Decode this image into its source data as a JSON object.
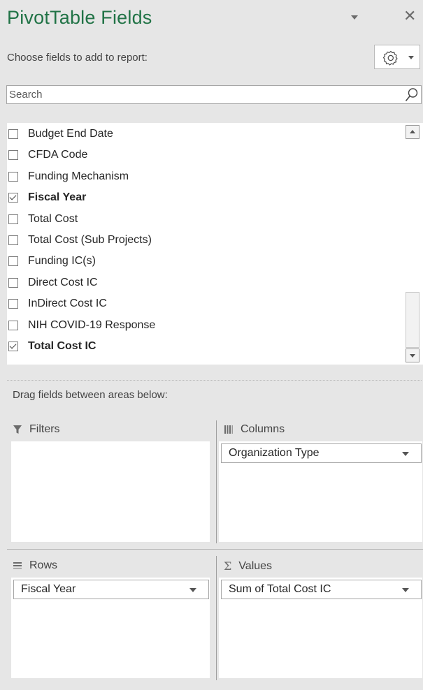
{
  "pane": {
    "title": "PivotTable Fields",
    "choose_label": "Choose fields to add to report:",
    "search_placeholder": "Search",
    "drag_label": "Drag fields between areas below:"
  },
  "fields": [
    {
      "label": "Budget End Date",
      "checked": false
    },
    {
      "label": "CFDA Code",
      "checked": false
    },
    {
      "label": "Funding Mechanism",
      "checked": false
    },
    {
      "label": "Fiscal Year",
      "checked": true
    },
    {
      "label": "Total Cost",
      "checked": false
    },
    {
      "label": "Total Cost (Sub Projects)",
      "checked": false
    },
    {
      "label": "Funding IC(s)",
      "checked": false
    },
    {
      "label": "Direct Cost IC",
      "checked": false
    },
    {
      "label": "InDirect Cost IC",
      "checked": false
    },
    {
      "label": "NIH COVID-19 Response",
      "checked": false
    },
    {
      "label": "Total Cost IC",
      "checked": true
    }
  ],
  "areas": {
    "filters": {
      "label": "Filters",
      "items": []
    },
    "columns": {
      "label": "Columns",
      "items": [
        "Organization Type"
      ]
    },
    "rows": {
      "label": "Rows",
      "items": [
        "Fiscal Year"
      ]
    },
    "values": {
      "label": "Values",
      "items": [
        "Sum of Total Cost IC"
      ]
    }
  },
  "colors": {
    "title": "#217346",
    "background": "#e6e6e6",
    "panel": "#ffffff"
  }
}
